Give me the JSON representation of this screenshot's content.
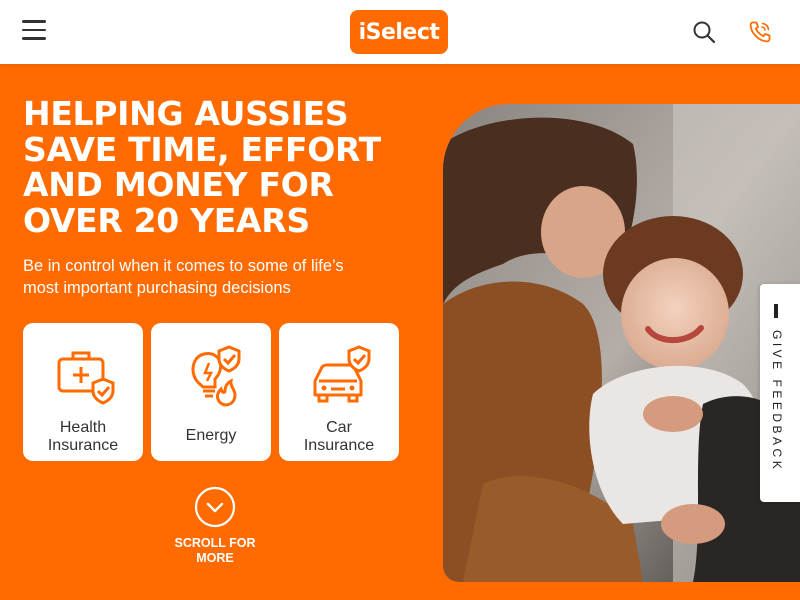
{
  "header": {
    "logo_text": "iSelect",
    "menu_icon": "hamburger-icon",
    "search_icon": "search-icon",
    "phone_icon": "phone-icon"
  },
  "hero": {
    "title": "HELPING AUSSIES SAVE TIME, EFFORT AND MONEY FOR OVER 20 YEARS",
    "subtitle": "Be in control when it comes to some of life’s most important purchasing decisions"
  },
  "categories": [
    {
      "label_line1": "Health",
      "label_line2": "Insurance",
      "icon": "health-insurance-icon"
    },
    {
      "label_line1": "Energy",
      "icon": "energy-icon"
    },
    {
      "label_line1": "Car",
      "label_line2": "Insurance",
      "icon": "car-insurance-icon"
    }
  ],
  "scroll": {
    "line1": "SCROLL FOR",
    "line2": "MORE",
    "icon": "chevron-down-icon"
  },
  "feedback": {
    "label": "GIVE FEEDBACK"
  },
  "colors": {
    "brand": "#ff6b00",
    "white": "#ffffff",
    "text": "#333333"
  }
}
